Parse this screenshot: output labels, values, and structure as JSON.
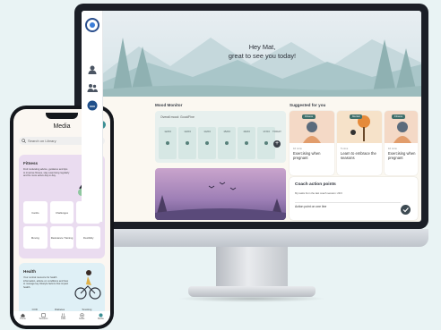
{
  "monitor": {
    "greeting_line1": "Hey Mat,",
    "greeting_line2": "great to see you today!",
    "mood_monitor": {
      "title": "Mood Monitor",
      "label": "Overall mood: Good/Fine",
      "days": [
        "12/23",
        "13/23",
        "14/23",
        "15/23",
        "16/23",
        "17/23"
      ],
      "today": "TODAY"
    },
    "suggested": {
      "title": "Suggested for you",
      "cards": [
        {
          "tag": "Fitness",
          "mins": "10 mins",
          "title": "Exercising when pregnant",
          "color": "#f4d9c6"
        },
        {
          "tag": "Mental",
          "mins": "5 mins",
          "title": "Learn to embrace the seasons",
          "color": "#f6e2c9"
        },
        {
          "tag": "Fitness",
          "mins": "10 mins",
          "title": "Exercising when pregnant",
          "color": "#f4d9c6"
        }
      ]
    },
    "coach": {
      "title": "Coach action points",
      "subtitle": "My tasks from the last coach session: 23/3",
      "point": "Action point on one line"
    }
  },
  "phone": {
    "title": "Media",
    "search_placeholder": "Search on Library",
    "fitness": {
      "title": "Fitness",
      "desc": "Find motivating advice, guidance and tips to improve fitness, stay exercising regularly and be more active day to day.",
      "tiles": [
        "Cardio",
        "Challenges",
        "Flexibility",
        "Moving",
        "Resistance Training",
        "Flexibility"
      ]
    },
    "health": {
      "title": "Health",
      "desc": "Your central resource for health information, advice on conditions and how to manage key lifestyle factors that impact health.",
      "row": [
        "COD",
        "Diabetes",
        "Smoking"
      ]
    },
    "nav": [
      "Home",
      "Sessions",
      "Labs",
      "Goals",
      "Media"
    ]
  },
  "colors": {
    "accent": "#3c8f94",
    "mood_panel": "#e7f0ee",
    "fitness_panel": "#eadcf0",
    "health_panel": "#dff0f6"
  }
}
